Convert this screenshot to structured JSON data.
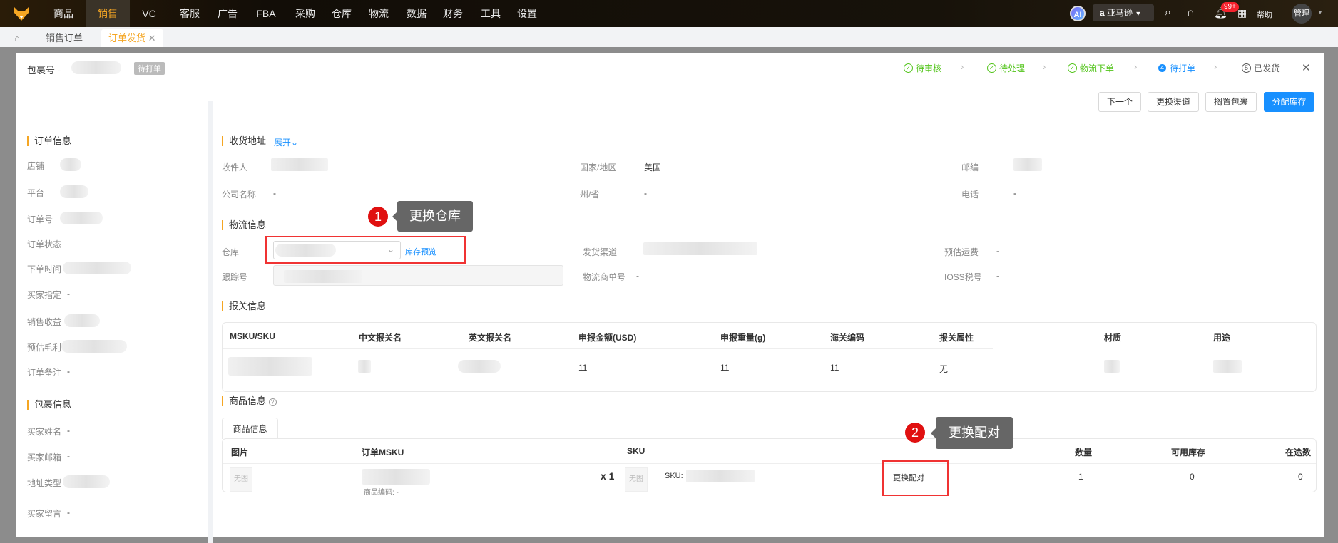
{
  "nav": {
    "items": [
      "商品",
      "销售",
      "VC",
      "客服",
      "广告",
      "FBA",
      "采购",
      "仓库",
      "物流",
      "数据",
      "财务",
      "工具",
      "设置"
    ],
    "active": 1,
    "ai": "AI",
    "marketplace": "亚马逊",
    "badge": "99+",
    "help": "帮助",
    "user": "管理"
  },
  "tabs": {
    "items": [
      "销售订单",
      "订单发货"
    ]
  },
  "modal": {
    "title": "包裹号 -",
    "status": "待打单",
    "steps": [
      {
        "label": "待审核",
        "icon": "✓"
      },
      {
        "label": "待处理",
        "icon": "✓"
      },
      {
        "label": "物流下单",
        "icon": "✓"
      },
      {
        "label": "待打单",
        "icon": "4"
      },
      {
        "label": "已发货",
        "icon": "5"
      }
    ],
    "buttons": {
      "next": "下一个",
      "change_channel": "更换渠道",
      "hold": "搁置包裹",
      "allocate": "分配库存"
    }
  },
  "left": {
    "order_title": "订单信息",
    "order_fields": [
      "店铺",
      "平台",
      "订单号",
      "订单状态",
      "下单时间",
      "买家指定",
      "销售收益",
      "预估毛利",
      "订单备注"
    ],
    "buyer_specified": "-",
    "order_note": "-",
    "package_title": "包裹信息",
    "package_fields": [
      "买家姓名",
      "买家邮箱",
      "地址类型",
      "买家留言"
    ],
    "buyer_name": "-",
    "buyer_email": "-",
    "buyer_message": "-"
  },
  "address": {
    "title": "收货地址",
    "expand": "展开",
    "recipient": "收件人",
    "country_label": "国家/地区",
    "country": "美国",
    "zip": "邮编",
    "company": "公司名称",
    "company_val": "-",
    "state": "州/省",
    "state_val": "-",
    "phone": "电话",
    "phone_val": "-"
  },
  "logistics": {
    "title": "物流信息",
    "warehouse": "仓库",
    "stock_preview": "库存预览",
    "channel": "发货渠道",
    "freight": "预估运费",
    "freight_val": "-",
    "tracking": "跟踪号",
    "logistics_no": "物流商单号",
    "logistics_no_val": "-",
    "ioss": "IOSS税号",
    "ioss_val": "-"
  },
  "customs": {
    "title": "报关信息",
    "headers": [
      "MSKU/SKU",
      "中文报关名",
      "英文报关名",
      "申报金额(USD)",
      "申报重量(g)",
      "海关编码",
      "报关属性",
      "材质",
      "用途"
    ],
    "row": {
      "amount": "11",
      "weight": "11",
      "hs": "11",
      "attr": "无"
    }
  },
  "products": {
    "title": "商品信息",
    "help_icon": "?",
    "tab": "商品信息",
    "headers": [
      "图片",
      "订单MSKU",
      "SKU",
      "数量",
      "可用库存",
      "在途数"
    ],
    "row": {
      "no_image": "无图",
      "qty_mult": "x 1",
      "product_code": "商品编码: -",
      "sku_label": "SKU:",
      "rematch": "更换配对",
      "qty": "1",
      "available": "0",
      "in_transit": "0"
    }
  },
  "annotations": [
    {
      "num": "1",
      "text": "更换仓库"
    },
    {
      "num": "2",
      "text": "更换配对"
    }
  ]
}
